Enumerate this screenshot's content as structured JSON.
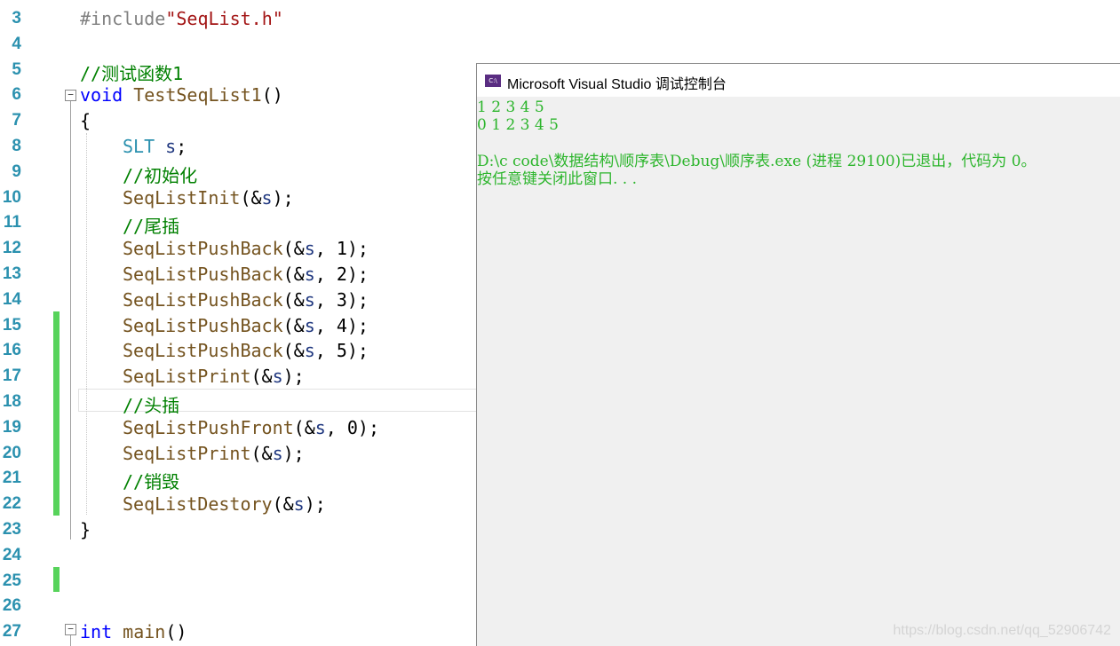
{
  "editor": {
    "lines": [
      {
        "num": "3",
        "tokens": [
          {
            "t": "#include",
            "c": "c-pp"
          },
          {
            "t": "\"SeqList.h\"",
            "c": "c-str"
          }
        ]
      },
      {
        "num": "4",
        "tokens": []
      },
      {
        "num": "5",
        "tokens": [
          {
            "t": "//测试函数1",
            "c": "c-cm"
          }
        ]
      },
      {
        "num": "6",
        "tokens": [
          {
            "t": "void",
            "c": "c-kw"
          },
          {
            "t": " ",
            "c": "c-txt"
          },
          {
            "t": "TestSeqList1",
            "c": "c-fn"
          },
          {
            "t": "()",
            "c": "c-txt"
          }
        ]
      },
      {
        "num": "7",
        "tokens": [
          {
            "t": "{",
            "c": "c-txt"
          }
        ]
      },
      {
        "num": "8",
        "tokens": [
          {
            "t": "SLT",
            "c": "c-type"
          },
          {
            "t": " ",
            "c": "c-txt"
          },
          {
            "t": "s",
            "c": "c-var"
          },
          {
            "t": ";",
            "c": "c-txt"
          }
        ]
      },
      {
        "num": "9",
        "tokens": [
          {
            "t": "//初始化",
            "c": "c-cm"
          }
        ]
      },
      {
        "num": "10",
        "tokens": [
          {
            "t": "SeqListInit",
            "c": "c-fn"
          },
          {
            "t": "(&",
            "c": "c-txt"
          },
          {
            "t": "s",
            "c": "c-var"
          },
          {
            "t": ");",
            "c": "c-txt"
          }
        ]
      },
      {
        "num": "11",
        "tokens": [
          {
            "t": "//尾插",
            "c": "c-cm"
          }
        ]
      },
      {
        "num": "12",
        "tokens": [
          {
            "t": "SeqListPushBack",
            "c": "c-fn"
          },
          {
            "t": "(&",
            "c": "c-txt"
          },
          {
            "t": "s",
            "c": "c-var"
          },
          {
            "t": ", 1);",
            "c": "c-txt"
          }
        ]
      },
      {
        "num": "13",
        "tokens": [
          {
            "t": "SeqListPushBack",
            "c": "c-fn"
          },
          {
            "t": "(&",
            "c": "c-txt"
          },
          {
            "t": "s",
            "c": "c-var"
          },
          {
            "t": ", 2);",
            "c": "c-txt"
          }
        ]
      },
      {
        "num": "14",
        "tokens": [
          {
            "t": "SeqListPushBack",
            "c": "c-fn"
          },
          {
            "t": "(&",
            "c": "c-txt"
          },
          {
            "t": "s",
            "c": "c-var"
          },
          {
            "t": ", 3);",
            "c": "c-txt"
          }
        ]
      },
      {
        "num": "15",
        "tokens": [
          {
            "t": "SeqListPushBack",
            "c": "c-fn"
          },
          {
            "t": "(&",
            "c": "c-txt"
          },
          {
            "t": "s",
            "c": "c-var"
          },
          {
            "t": ", 4);",
            "c": "c-txt"
          }
        ]
      },
      {
        "num": "16",
        "tokens": [
          {
            "t": "SeqListPushBack",
            "c": "c-fn"
          },
          {
            "t": "(&",
            "c": "c-txt"
          },
          {
            "t": "s",
            "c": "c-var"
          },
          {
            "t": ", 5);",
            "c": "c-txt"
          }
        ]
      },
      {
        "num": "17",
        "tokens": [
          {
            "t": "SeqListPrint",
            "c": "c-fn"
          },
          {
            "t": "(&",
            "c": "c-txt"
          },
          {
            "t": "s",
            "c": "c-var"
          },
          {
            "t": ");",
            "c": "c-txt"
          }
        ]
      },
      {
        "num": "18",
        "tokens": [
          {
            "t": "//头插",
            "c": "c-cm"
          }
        ]
      },
      {
        "num": "19",
        "tokens": [
          {
            "t": "SeqListPushFront",
            "c": "c-fn"
          },
          {
            "t": "(&",
            "c": "c-txt"
          },
          {
            "t": "s",
            "c": "c-var"
          },
          {
            "t": ", 0);",
            "c": "c-txt"
          }
        ]
      },
      {
        "num": "20",
        "tokens": [
          {
            "t": "SeqListPrint",
            "c": "c-fn"
          },
          {
            "t": "(&",
            "c": "c-txt"
          },
          {
            "t": "s",
            "c": "c-var"
          },
          {
            "t": ");",
            "c": "c-txt"
          }
        ]
      },
      {
        "num": "21",
        "tokens": [
          {
            "t": "//销毁",
            "c": "c-cm"
          }
        ]
      },
      {
        "num": "22",
        "tokens": [
          {
            "t": "SeqListDestory",
            "c": "c-fn"
          },
          {
            "t": "(&",
            "c": "c-txt"
          },
          {
            "t": "s",
            "c": "c-var"
          },
          {
            "t": ");",
            "c": "c-txt"
          }
        ]
      },
      {
        "num": "23",
        "tokens": [
          {
            "t": "}",
            "c": "c-txt"
          }
        ]
      },
      {
        "num": "24",
        "tokens": []
      },
      {
        "num": "25",
        "tokens": []
      },
      {
        "num": "26",
        "tokens": []
      },
      {
        "num": "27",
        "tokens": [
          {
            "t": "int",
            "c": "c-kw"
          },
          {
            "t": " ",
            "c": "c-txt"
          },
          {
            "t": "main",
            "c": "c-fn"
          },
          {
            "t": "()",
            "c": "c-txt"
          }
        ]
      }
    ],
    "fold_glyph": "−"
  },
  "console": {
    "title": "Microsoft Visual Studio 调试控制台",
    "icon_label": "C:\\",
    "output": [
      "1 2 3 4 5",
      "0 1 2 3 4 5",
      "",
      "D:\\c code\\数据结构\\顺序表\\Debug\\顺序表.exe (进程 29100)已退出，代码为 0。",
      "按任意键关闭此窗口. . ."
    ]
  },
  "watermark": "https://blog.csdn.net/qq_52906742",
  "colors": {
    "line_number": "#2b91af",
    "keyword": "#0000ff",
    "type": "#2b91af",
    "function": "#74531f",
    "comment": "#008000",
    "string": "#a31515",
    "variable": "#1f377f",
    "console_text": "#2cb52c",
    "change_bar": "#57d35b"
  }
}
